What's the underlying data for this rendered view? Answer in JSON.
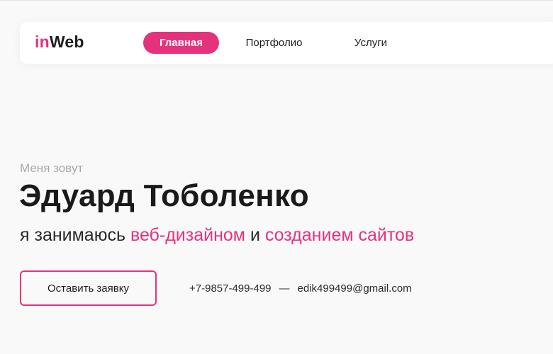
{
  "brand": {
    "logo_prefix": "in",
    "logo_suffix": "Web",
    "accent_color": "#e5327d"
  },
  "nav": {
    "items": [
      {
        "label": "Главная",
        "active": true
      },
      {
        "label": "Портфолио",
        "active": false
      },
      {
        "label": "Услуги",
        "active": false
      }
    ]
  },
  "hero": {
    "intro": "Меня зовут",
    "name": "Эдуард Тоболенко",
    "tagline_start": "я занимаюсь ",
    "tagline_highlight_1": "веб-дизайном",
    "tagline_middle": " и ",
    "tagline_highlight_2": "созданием сайтов"
  },
  "cta": {
    "label": "Оставить заявку"
  },
  "contacts": {
    "phone": "+7-9857-499-499",
    "separator": "—",
    "email": "edik499499@gmail.com"
  }
}
